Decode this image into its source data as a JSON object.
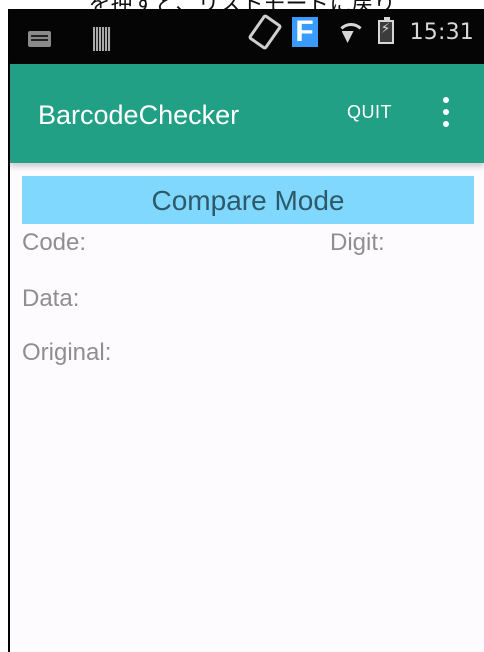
{
  "caption": {
    "text": "を押すと、リストモードに戻り"
  },
  "status_bar": {
    "time": "15:31",
    "icons": [
      "keyboard-icon",
      "barcode-icon",
      "rotate-icon",
      "f-icon",
      "wifi-icon",
      "battery-icon"
    ]
  },
  "app_bar": {
    "title": "BarcodeChecker",
    "quit_label": "QUIT",
    "overflow_icon": "more-vertical-icon",
    "background_color": "#21a085"
  },
  "main": {
    "mode_label": "Compare Mode",
    "mode_color": "#80d8ff",
    "fields": {
      "code_label": "Code:",
      "digit_label": "Digit:",
      "data_label": "Data:",
      "original_label": "Original:"
    }
  }
}
